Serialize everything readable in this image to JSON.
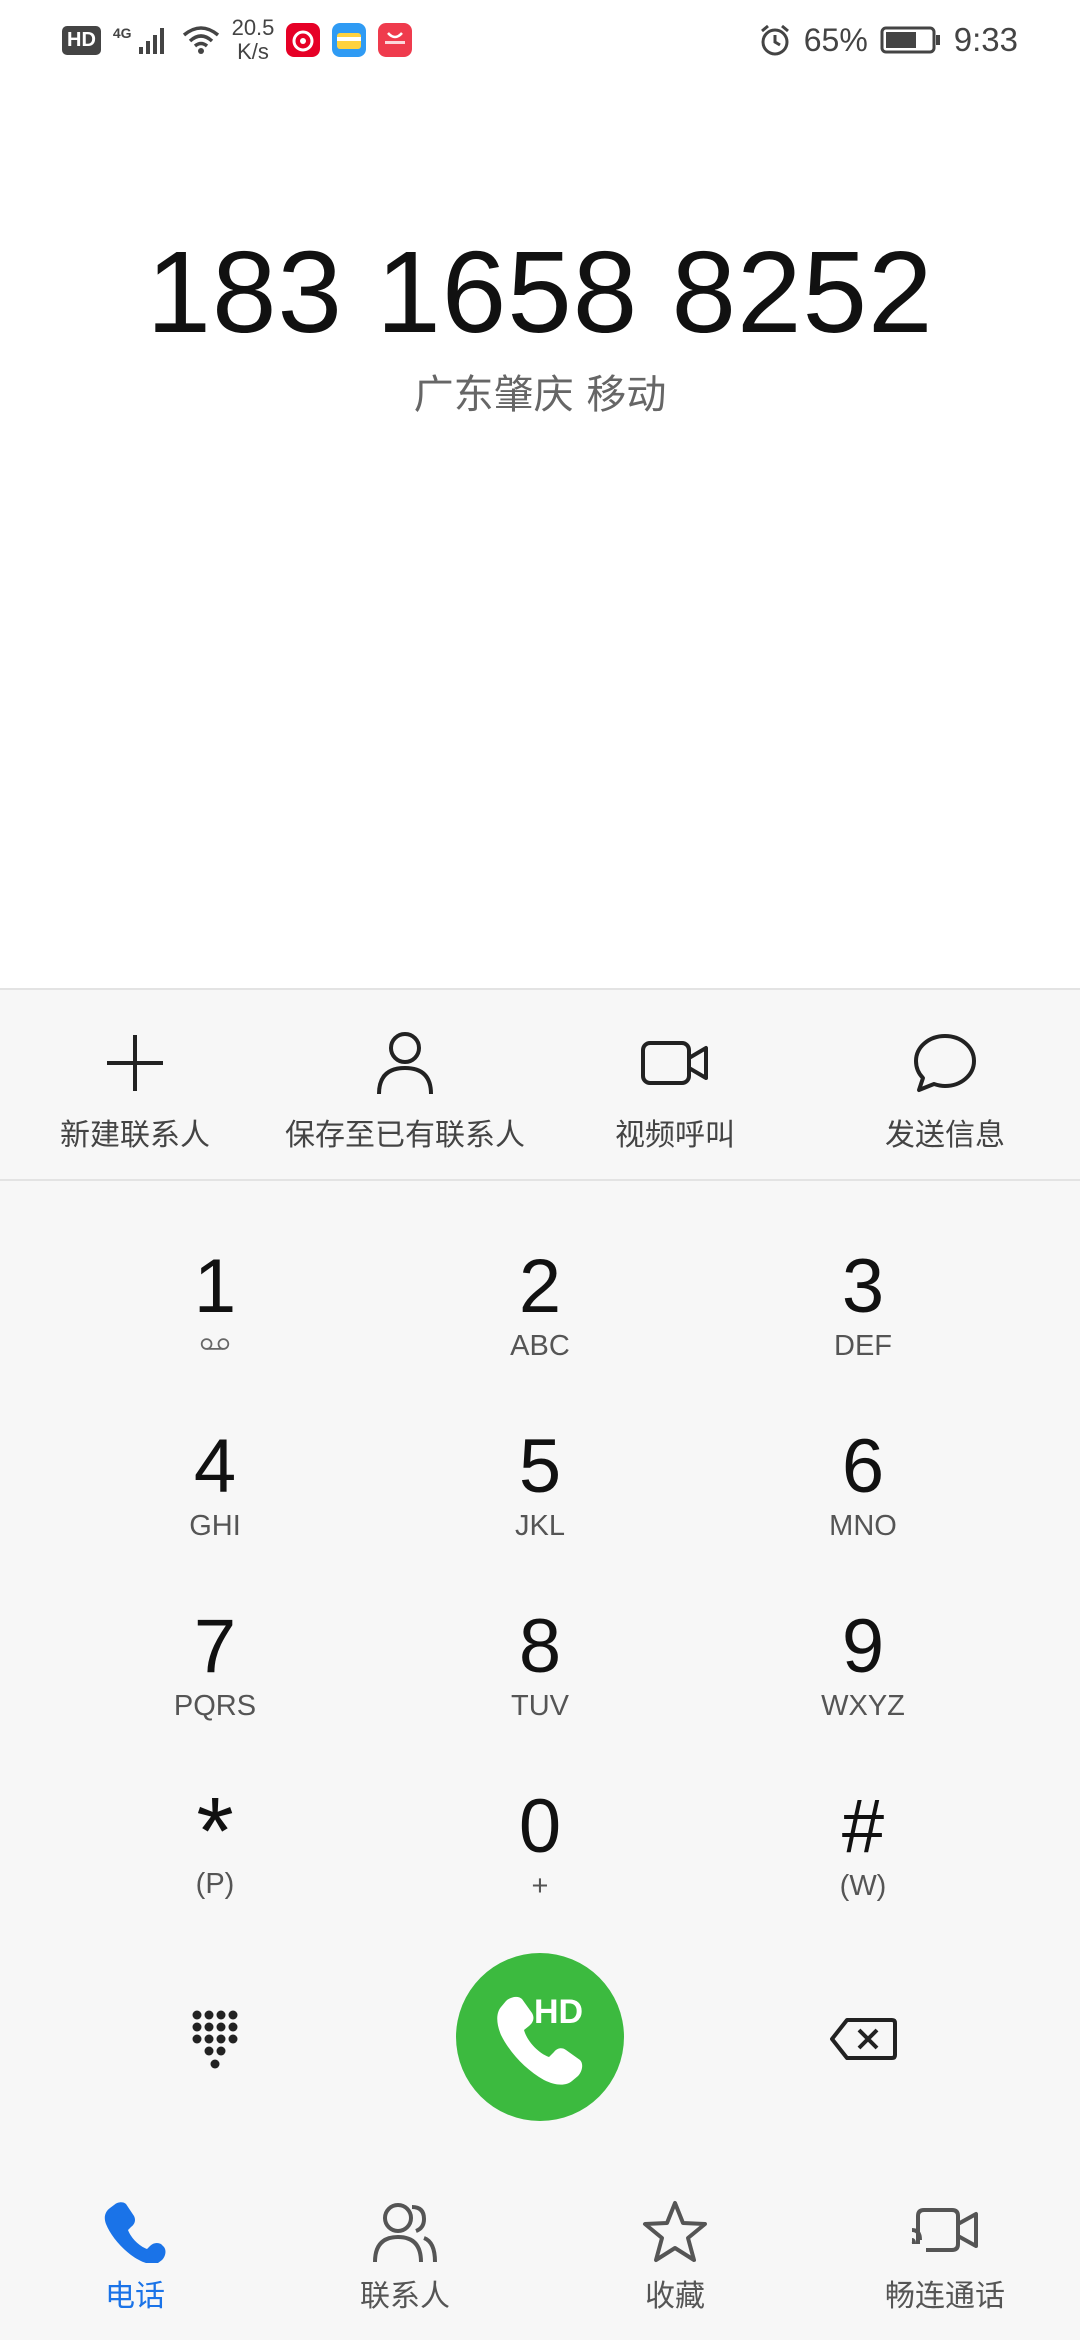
{
  "status_bar": {
    "hd": "HD",
    "network": "4G",
    "speed_value": "20.5",
    "speed_unit": "K/s",
    "battery": "65%",
    "time": "9:33",
    "apps": [
      "netease-music-icon",
      "wallet-icon",
      "huawei-store-icon"
    ]
  },
  "dialer": {
    "number": "183 1658 8252",
    "location": "广东肇庆 移动"
  },
  "actions": [
    {
      "label": "新建联系人",
      "icon": "plus-icon"
    },
    {
      "label": "保存至已有联系人",
      "icon": "person-icon"
    },
    {
      "label": "视频呼叫",
      "icon": "video-icon"
    },
    {
      "label": "发送信息",
      "icon": "message-icon"
    }
  ],
  "keys": [
    {
      "digit": "1",
      "letters": ""
    },
    {
      "digit": "2",
      "letters": "ABC"
    },
    {
      "digit": "3",
      "letters": "DEF"
    },
    {
      "digit": "4",
      "letters": "GHI"
    },
    {
      "digit": "5",
      "letters": "JKL"
    },
    {
      "digit": "6",
      "letters": "MNO"
    },
    {
      "digit": "7",
      "letters": "PQRS"
    },
    {
      "digit": "8",
      "letters": "TUV"
    },
    {
      "digit": "9",
      "letters": "WXYZ"
    },
    {
      "digit": "*",
      "letters": "(P)"
    },
    {
      "digit": "0",
      "letters": "+"
    },
    {
      "digit": "#",
      "letters": "(W)"
    }
  ],
  "call": {
    "badge": "HD"
  },
  "nav": [
    {
      "label": "电话",
      "icon": "phone-icon",
      "active": true
    },
    {
      "label": "联系人",
      "icon": "contacts-icon",
      "active": false
    },
    {
      "label": "收藏",
      "icon": "star-icon",
      "active": false
    },
    {
      "label": "畅连通话",
      "icon": "meetime-icon",
      "active": false
    }
  ],
  "colors": {
    "accent": "#1a73e8",
    "call_green": "#3cba3f",
    "panel_bg": "#f7f7f7"
  }
}
